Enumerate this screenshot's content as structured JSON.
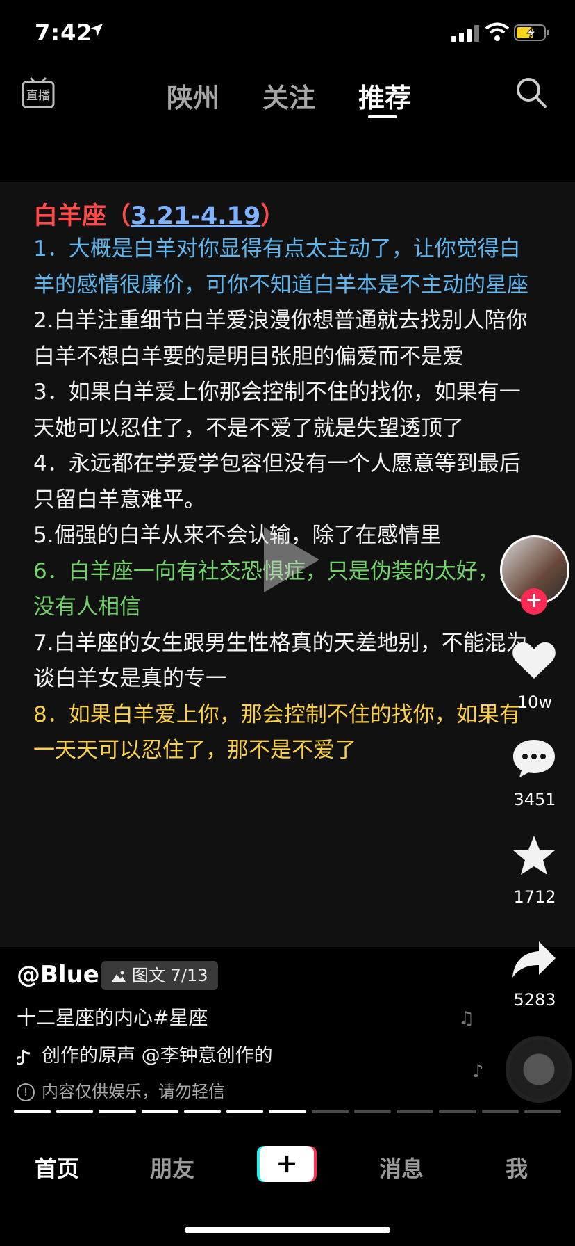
{
  "status": {
    "time": "7:42"
  },
  "topnav": {
    "live_label": "直播",
    "tabs": [
      {
        "label": "陕州",
        "active": false
      },
      {
        "label": "关注",
        "active": false
      },
      {
        "label": "推荐",
        "active": true
      }
    ]
  },
  "post": {
    "heading_title": "白羊座（",
    "heading_date": "3.21-4.19",
    "heading_close": "）",
    "lines": [
      {
        "text": "1．大概是白羊对你显得有点太主动了，让你觉得白",
        "color": "blue"
      },
      {
        "text": "羊的感情很廉价，可你不知道白羊本是不主动的星座",
        "color": "blue"
      },
      {
        "text": "2.白羊注重细节白羊爱浪漫你想普通就去找别人陪你",
        "color": "white"
      },
      {
        "text": "白羊不想白羊要的是明目张胆的偏爱而不是爱",
        "color": "white"
      },
      {
        "text": "3．如果白羊爱上你那会控制不住的找你，如果有一",
        "color": "white"
      },
      {
        "text": "天她可以忍住了，不是不爱了就是失望透顶了",
        "color": "white"
      },
      {
        "text": "4．永远都在学爱学包容但没有一个人愿意等到最后",
        "color": "white"
      },
      {
        "text": "只留白羊意难平。",
        "color": "white"
      },
      {
        "text": "5.倔强的白羊从来不会认输，除了在感情里",
        "color": "white"
      },
      {
        "text": "6．白羊座一向有社交恐惧症，只是伪装的太好，从",
        "color": "green"
      },
      {
        "text": "没有人相信",
        "color": "green"
      },
      {
        "text": "7.白羊座的女生跟男生性格真的天差地别，不能混为",
        "color": "white"
      },
      {
        "text": "谈白羊女是真的专一",
        "color": "white"
      },
      {
        "text": "8．如果白羊爱上你，那会控制不住的找你，如果有",
        "color": "yellow"
      },
      {
        "text": "一天天可以忍住了，那不是不爱了",
        "color": "yellow"
      }
    ]
  },
  "rail": {
    "likes": "10w",
    "comments": "3451",
    "favorites": "1712",
    "shares": "5283"
  },
  "info": {
    "author": "@Blue.",
    "badge": "图文 7/13",
    "description": "十二星座的内心#星座",
    "music": "创作的原声    @李钟意创作的",
    "disclaimer": "内容仅供娱乐，请勿轻信"
  },
  "progress": {
    "current": 7,
    "total": 13
  },
  "tabbar": {
    "home": "首页",
    "friends": "朋友",
    "create": "+",
    "messages": "消息",
    "me": "我"
  },
  "colors": {
    "heading_red": "#ff4a49",
    "blue": "#5fb5ee",
    "green": "#72d36a",
    "yellow": "#fad04a",
    "accent_pink": "#fe2c55",
    "accent_cyan": "#25f4ee"
  }
}
